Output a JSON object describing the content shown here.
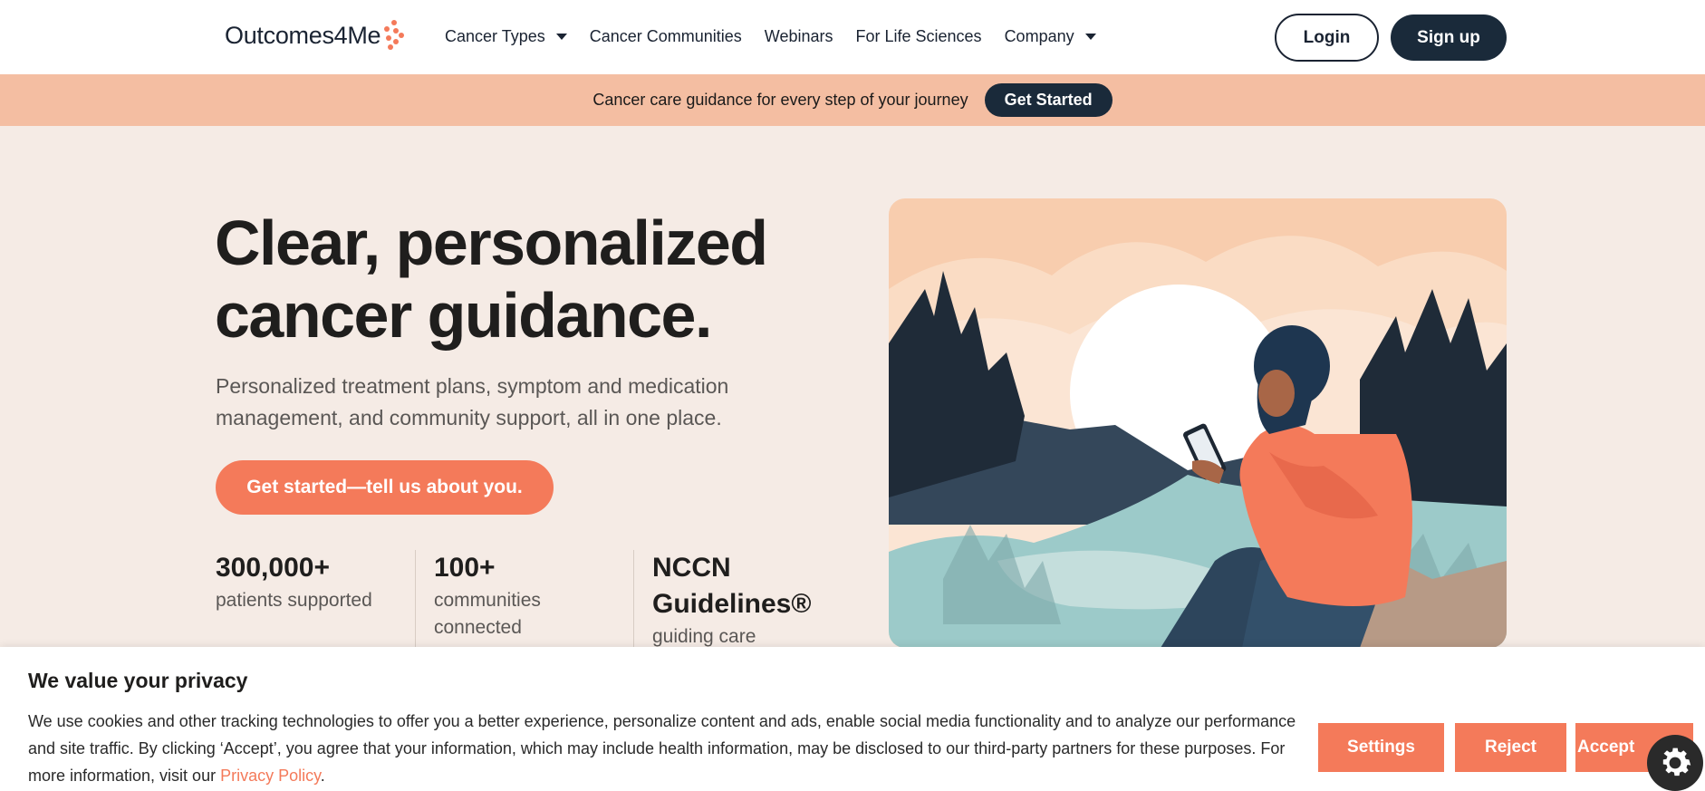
{
  "brand": {
    "name": "Outcomes4Me",
    "accent": "#f47a5a",
    "dark": "#1a2a3a"
  },
  "nav": {
    "items": [
      {
        "label": "Cancer Types",
        "dropdown": true
      },
      {
        "label": "Cancer Communities",
        "dropdown": false
      },
      {
        "label": "Webinars",
        "dropdown": false
      },
      {
        "label": "For Life Sciences",
        "dropdown": false
      },
      {
        "label": "Company",
        "dropdown": true
      }
    ],
    "login": "Login",
    "signup": "Sign up"
  },
  "banner": {
    "text": "Cancer care guidance for every step of your journey",
    "button": "Get Started"
  },
  "hero": {
    "title_line1": "Clear, personalized",
    "title_line2": "cancer guidance.",
    "subtitle": "Personalized treatment plans, symptom and medication management, and community support, all in one place.",
    "cta": "Get started—tell us about you."
  },
  "stats": [
    {
      "value": "300,000+",
      "label": "patients supported"
    },
    {
      "value": "100+",
      "label": "communities connected"
    },
    {
      "value_line1": "NCCN",
      "value_line2": "Guidelines®",
      "label": "guiding care"
    }
  ],
  "cookie": {
    "title": "We value your privacy",
    "text": "We use cookies and other tracking technologies to offer you a better experience, personalize content and ads, enable social media functionality and to analyze our performance and site traffic. By clicking ‘Accept’, you agree that your information, which may include health information, may be disclosed to our third-party partners for these purposes. For more information, visit our ",
    "link": "Privacy Policy",
    "after_link": ".",
    "buttons": {
      "settings": "Settings",
      "reject": "Reject",
      "accept": "Accept"
    },
    "gear_icon": "gear-icon"
  }
}
